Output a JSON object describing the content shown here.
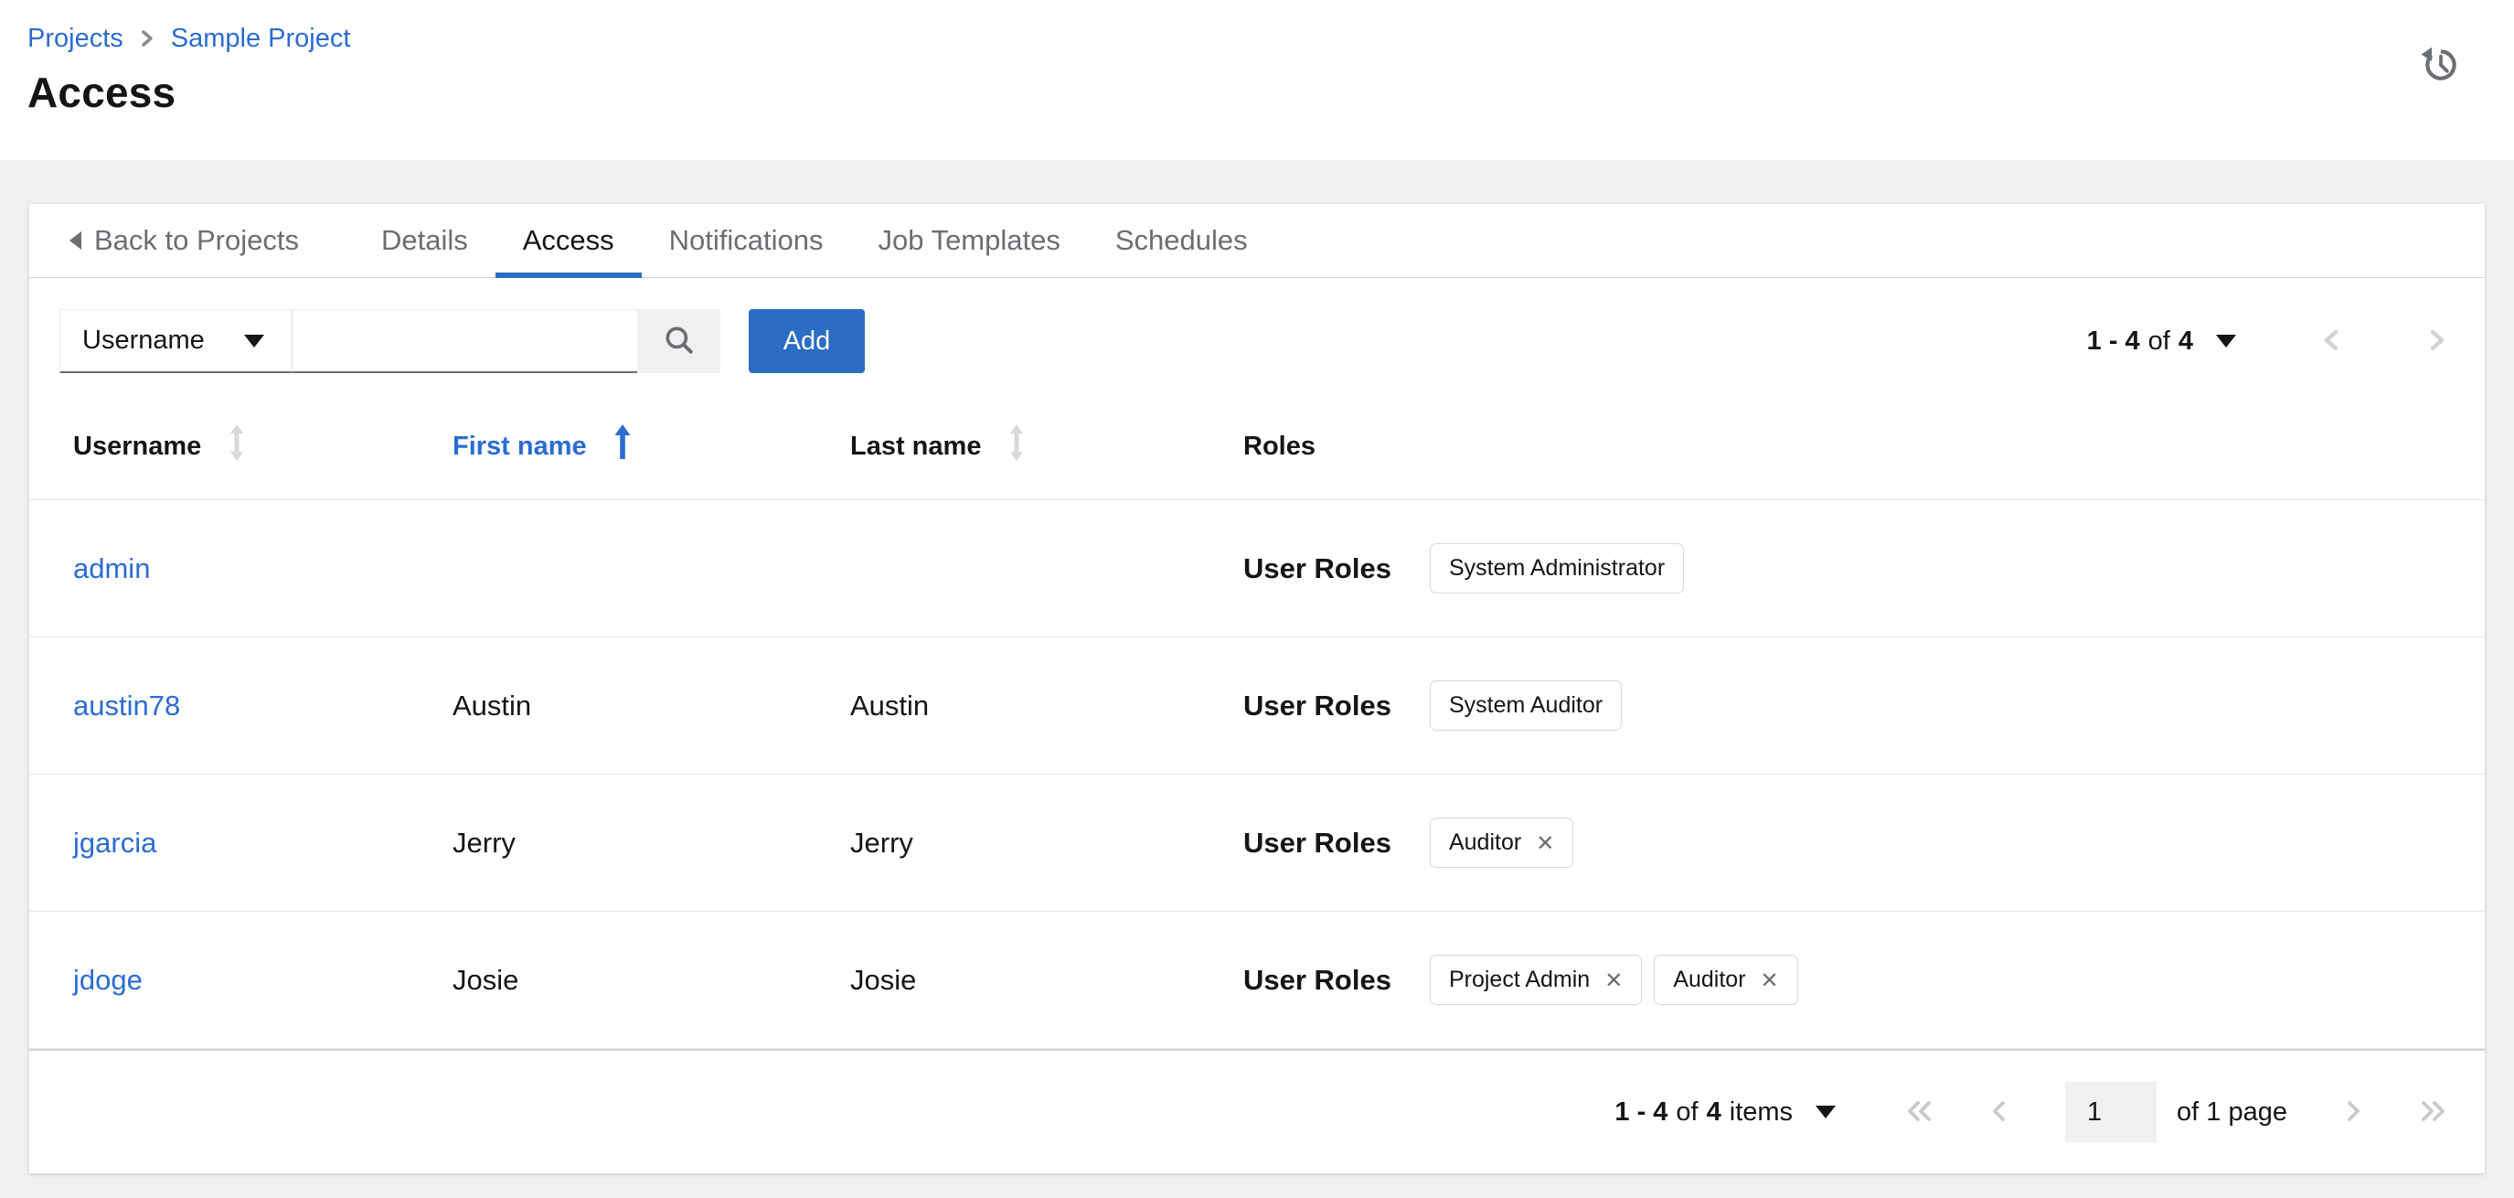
{
  "page": {
    "title": "Access"
  },
  "breadcrumb": {
    "items": [
      "Projects",
      "Sample Project"
    ]
  },
  "tabs": {
    "back_label": "Back to Projects",
    "items": [
      {
        "label": "Details"
      },
      {
        "label": "Access"
      },
      {
        "label": "Notifications"
      },
      {
        "label": "Job Templates"
      },
      {
        "label": "Schedules"
      }
    ]
  },
  "toolbar": {
    "filter_select": {
      "value": "Username"
    },
    "search_input": {
      "value": "",
      "placeholder": ""
    },
    "add_button_label": "Add",
    "pagination": {
      "range": "1 - 4",
      "of": "of",
      "total": "4"
    }
  },
  "table": {
    "columns": [
      {
        "label": "Username",
        "sort": "sortable"
      },
      {
        "label": "First name",
        "sort": "ascending"
      },
      {
        "label": "Last name",
        "sort": "sortable"
      },
      {
        "label": "Roles",
        "sort": "none"
      }
    ],
    "roles_cell_label": "User Roles",
    "rows": [
      {
        "username": "admin",
        "first_name": "",
        "last_name": "",
        "roles": [
          {
            "label": "System Administrator",
            "removable": false
          }
        ]
      },
      {
        "username": "austin78",
        "first_name": "Austin",
        "last_name": "Austin",
        "roles": [
          {
            "label": "System Auditor",
            "removable": false
          }
        ]
      },
      {
        "username": "jgarcia",
        "first_name": "Jerry",
        "last_name": "Jerry",
        "roles": [
          {
            "label": "Auditor",
            "removable": true
          }
        ]
      },
      {
        "username": "jdoge",
        "first_name": "Josie",
        "last_name": "Josie",
        "roles": [
          {
            "label": "Project Admin",
            "removable": true
          },
          {
            "label": "Auditor",
            "removable": true
          }
        ]
      }
    ]
  },
  "footer": {
    "pagination": {
      "range": "1 - 4",
      "of": "of",
      "total": "4",
      "items_word": "items",
      "page_value": "1",
      "page_of_label": "of 1 page"
    }
  },
  "icons": {
    "close": "✕"
  },
  "colors": {
    "link": "#2b6cd4",
    "primary": "#2b6cc4",
    "text": "#151515",
    "muted": "#6a6e73",
    "border": "#d2d2d2",
    "background": "#f0f0f0",
    "disabled_chevron": "#d2d2d2"
  }
}
